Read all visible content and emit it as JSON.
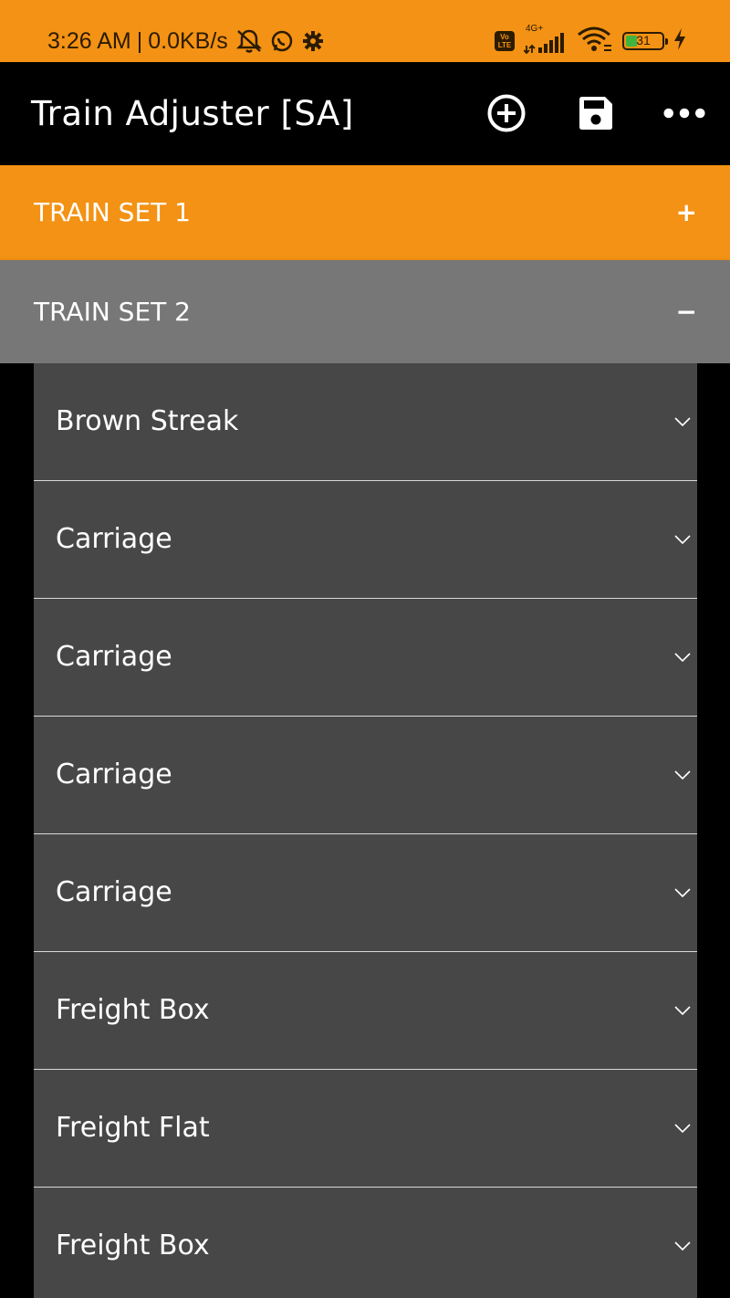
{
  "status_bar": {
    "time": "3:26 AM",
    "separator": "|",
    "speed": "0.0KB/s",
    "network_badge_top": "Vo",
    "network_badge_bottom": "LTE",
    "network_type": "4G+",
    "battery_level": "31",
    "battery_fraction": 0.31,
    "icons": [
      "mute-notifications-icon",
      "whatsapp-icon",
      "settings-gear-icon",
      "volte-icon",
      "signal-icon",
      "wifi-icon",
      "battery-icon",
      "charging-bolt-icon"
    ]
  },
  "app_bar": {
    "title": "Train Adjuster [SA]",
    "actions": [
      "add-circle-icon",
      "save-icon",
      "more-options-icon"
    ]
  },
  "train_sets": [
    {
      "label": "TRAIN SET 1",
      "toggle": "+",
      "expanded": false,
      "color": "#F39214"
    },
    {
      "label": "TRAIN SET 2",
      "toggle": "−",
      "expanded": true,
      "color": "#777777"
    }
  ],
  "cars": [
    {
      "name": "Brown Streak"
    },
    {
      "name": "Carriage"
    },
    {
      "name": "Carriage"
    },
    {
      "name": "Carriage"
    },
    {
      "name": "Carriage"
    },
    {
      "name": "Freight Box"
    },
    {
      "name": "Freight Flat"
    },
    {
      "name": "Freight Box"
    }
  ],
  "colors": {
    "accent": "#F39214",
    "app_bar": "#000000",
    "expanded_header": "#777777",
    "list_item": "#474747",
    "divider": "#d8d8d8"
  }
}
